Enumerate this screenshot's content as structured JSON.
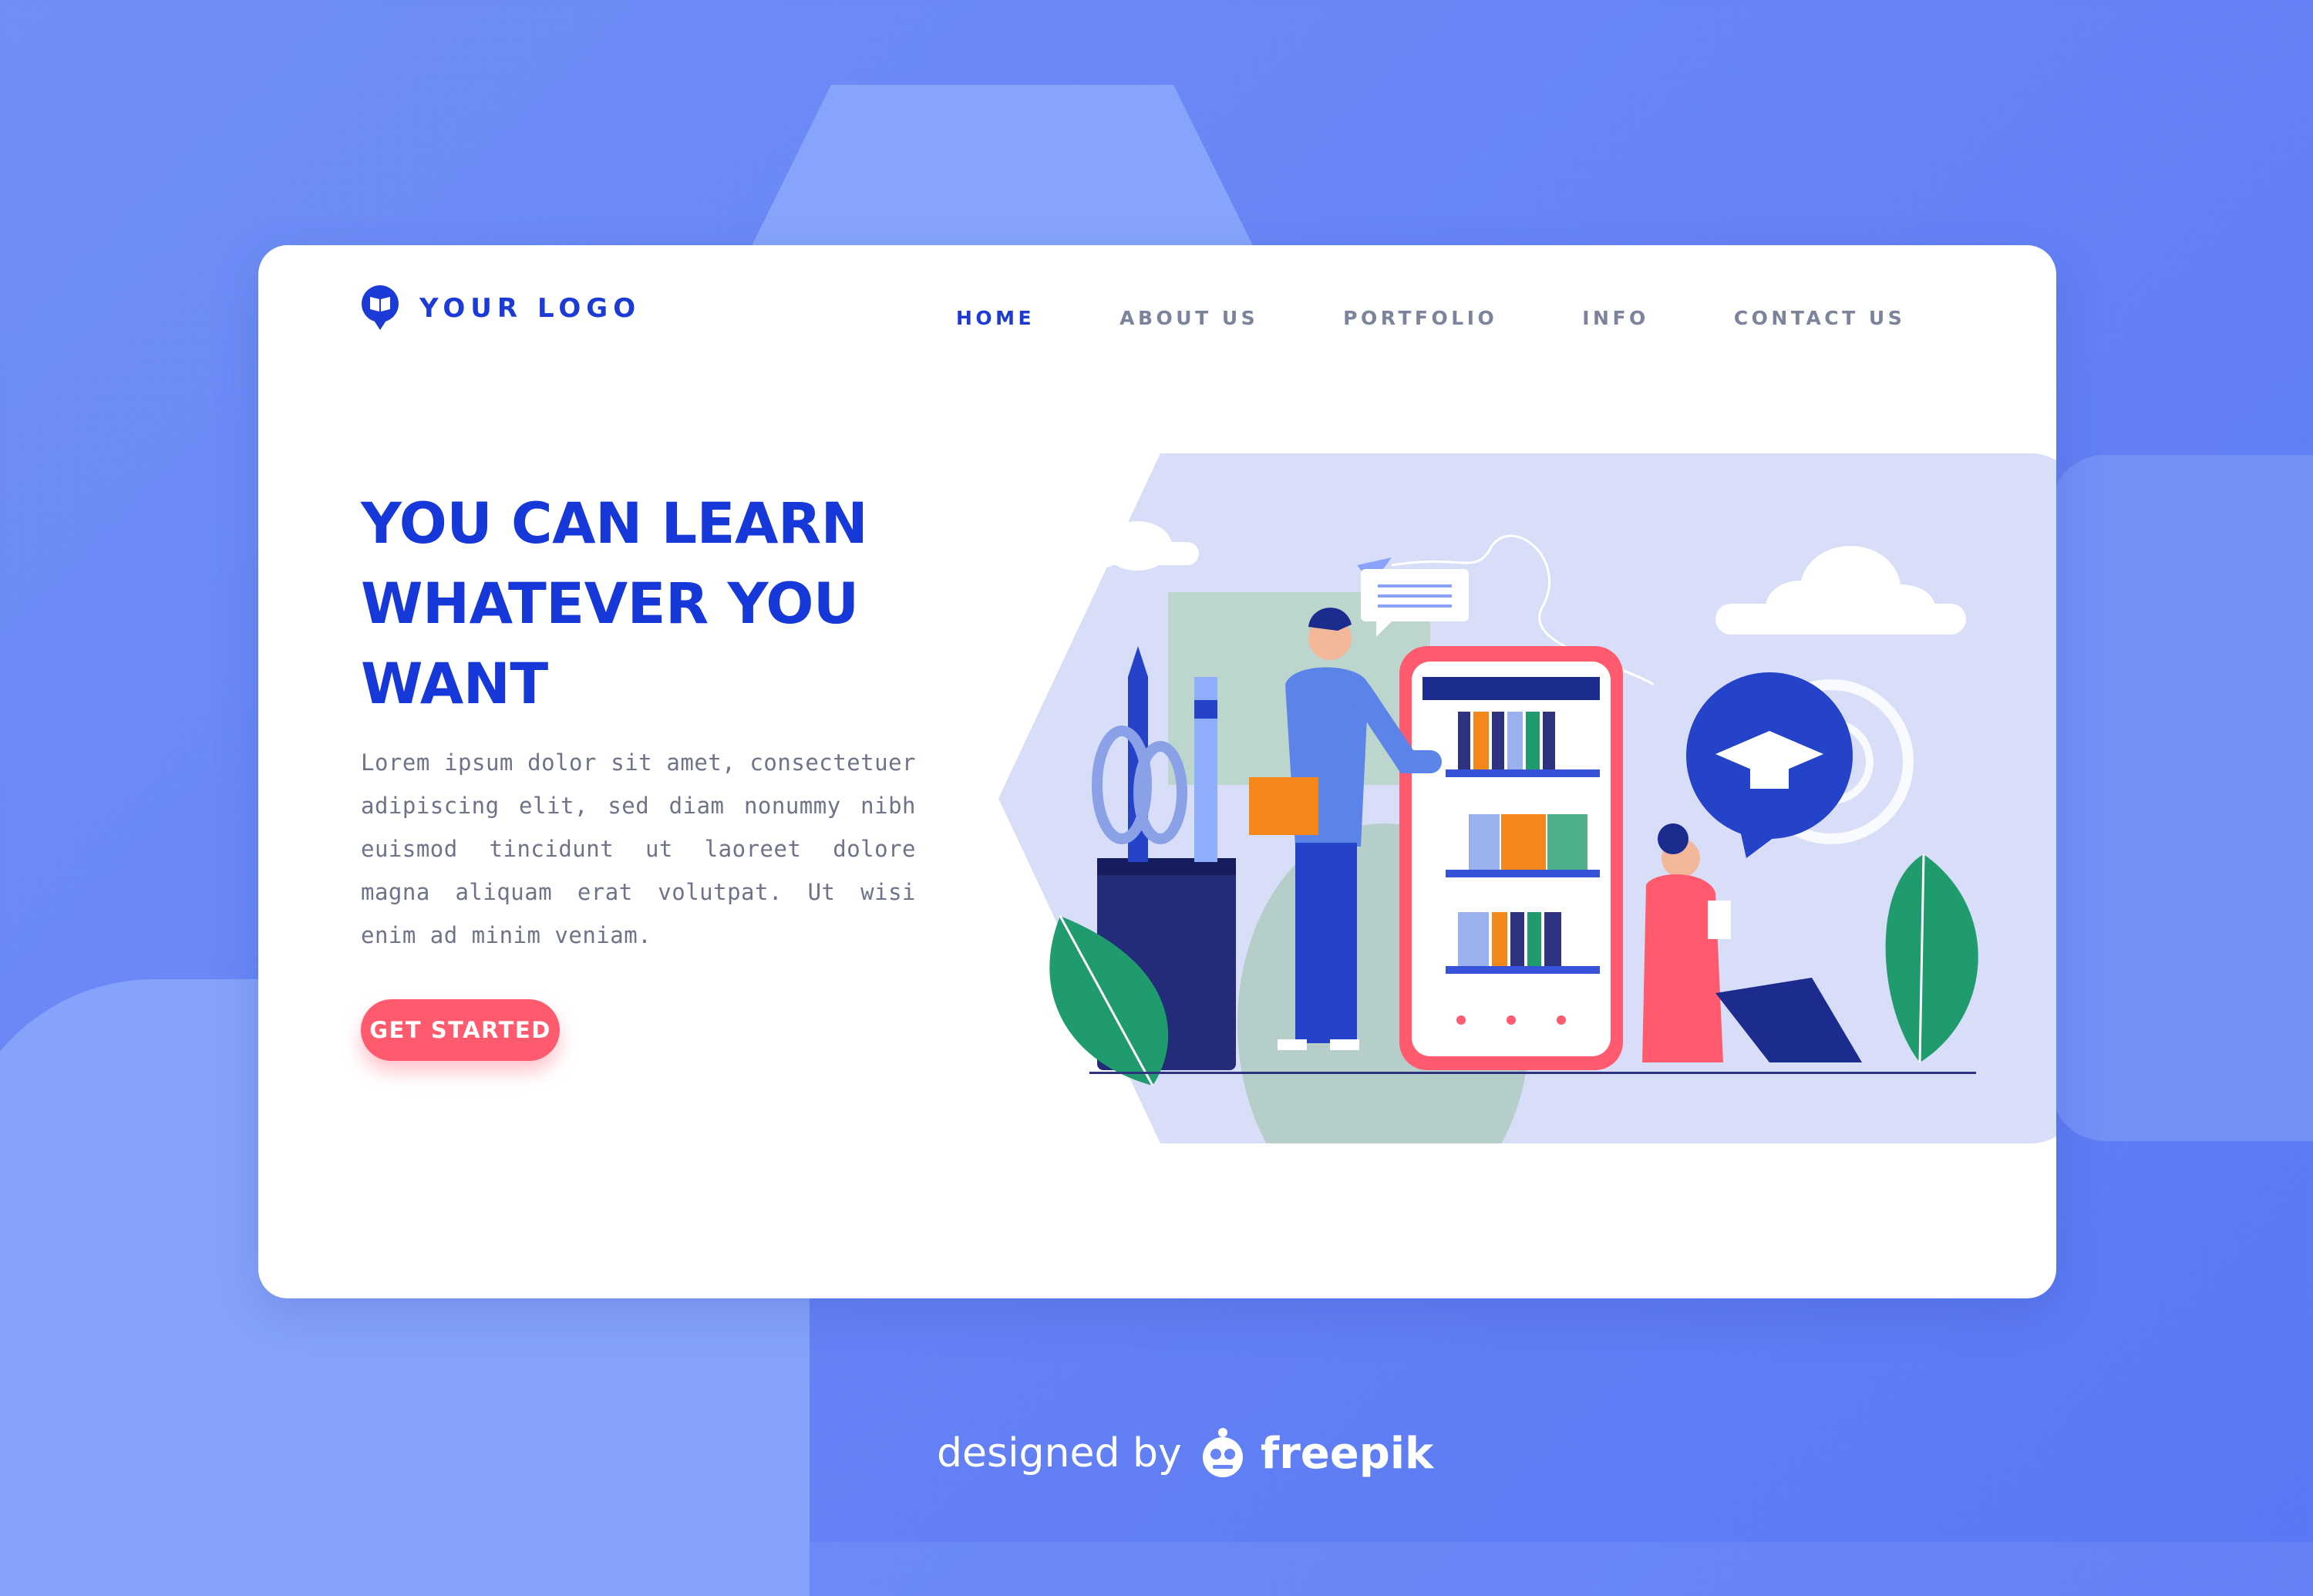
{
  "brand": {
    "logo_text": "YOUR LOGO"
  },
  "nav": {
    "items": [
      {
        "label": "HOME",
        "active": true
      },
      {
        "label": "ABOUT US",
        "active": false
      },
      {
        "label": "PORTFOLIO",
        "active": false
      },
      {
        "label": "INFO",
        "active": false
      },
      {
        "label": "CONTACT US",
        "active": false
      }
    ]
  },
  "hero": {
    "title": "YOU CAN LEARN WHATEVER YOU WANT",
    "description": "Lorem ipsum dolor sit amet, consectetuer adipiscing elit, sed diam nonummy nibh euismod tincidunt ut laoreet dolore magna aliquam erat volutpat. Ut wisi enim ad minim veniam.",
    "cta_label": "GET STARTED"
  },
  "footer": {
    "text": "designed by",
    "brand": "freepik"
  },
  "colors": {
    "accent": "#1638d9",
    "cta": "#ff5a6e",
    "background": "#6684f5",
    "panel": "#d8def8"
  }
}
